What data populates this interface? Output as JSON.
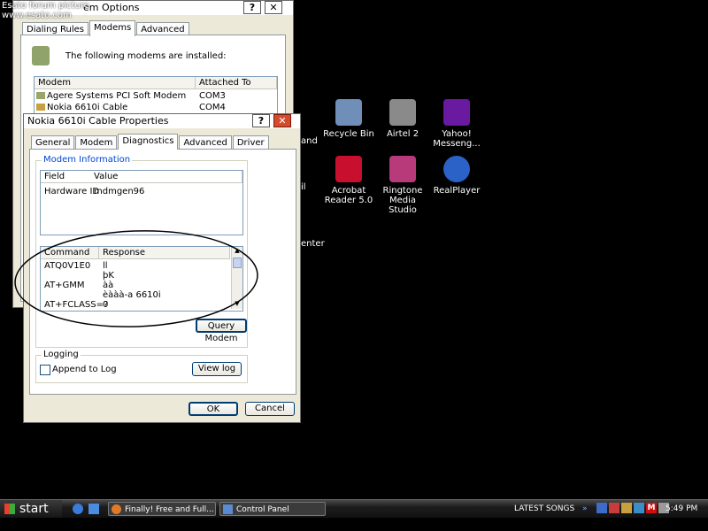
{
  "watermark": {
    "line1": "Esato forum picture",
    "line2": "www.esato.com"
  },
  "back_window": {
    "title": "Phone and Modem Options",
    "title_visible": "em Options",
    "tabs": [
      "Dialing Rules",
      "Modems",
      "Advanced"
    ],
    "active_tab": "Modems",
    "intro": "The following modems are installed:",
    "columns": [
      "Modem",
      "Attached To"
    ],
    "rows": [
      {
        "modem": "Agere Systems PCI Soft Modem",
        "port": "COM3"
      },
      {
        "modem": "Nokia 6610i Cable",
        "port": "COM4"
      }
    ]
  },
  "front_window": {
    "title": "Nokia 6610i Cable Properties",
    "tabs": [
      "General",
      "Modem",
      "Diagnostics",
      "Advanced",
      "Driver"
    ],
    "active_tab": "Diagnostics",
    "modem_info_label": "Modem Information",
    "info_columns": [
      "Field",
      "Value"
    ],
    "info_rows": [
      {
        "field": "Hardware ID",
        "value": "mdmgen96"
      }
    ],
    "cmd_columns": [
      "Command",
      "Response"
    ],
    "cmd_rows": [
      {
        "cmd": "ATQ0V1E0",
        "resp": "ll"
      },
      {
        "cmd": "",
        "resp": "þK"
      },
      {
        "cmd": "AT+GMM",
        "resp": "àà"
      },
      {
        "cmd": "",
        "resp": "èààà-a 6610i"
      },
      {
        "cmd": "AT+FCLASS=?",
        "resp": "0"
      }
    ],
    "query_button": "Query Modem",
    "logging_label": "Logging",
    "append_label": "Append to Log",
    "viewlog_button": "View log",
    "ok_button": "OK",
    "cancel_button": "Cancel"
  },
  "desktop_icons": [
    {
      "label": "Recycle Bin",
      "color": "#6f8fb8"
    },
    {
      "label": "Airtel 2",
      "color": "#8a8a8a"
    },
    {
      "label": "Yahoo! Messeng...",
      "color": "#6a1aa0"
    },
    {
      "label": "Acrobat Reader 5.0",
      "color": "#c8102e"
    },
    {
      "label": "Ringtone Media Studio",
      "color": "#b83a7a"
    },
    {
      "label": "RealPlayer",
      "color": "#2a62c8"
    }
  ],
  "partial_labels": [
    "and",
    "il",
    "enter"
  ],
  "taskbar": {
    "start": "start",
    "tasks": [
      "Finally! Free and Full...",
      "Control Panel"
    ],
    "tray_text": "LATEST SONGS",
    "tray_arrows": "»",
    "clock": "5:49 PM"
  },
  "colors": {
    "desktop": "#000000",
    "window_face": "#ece9d8",
    "focus_blue": "#0046d5"
  }
}
